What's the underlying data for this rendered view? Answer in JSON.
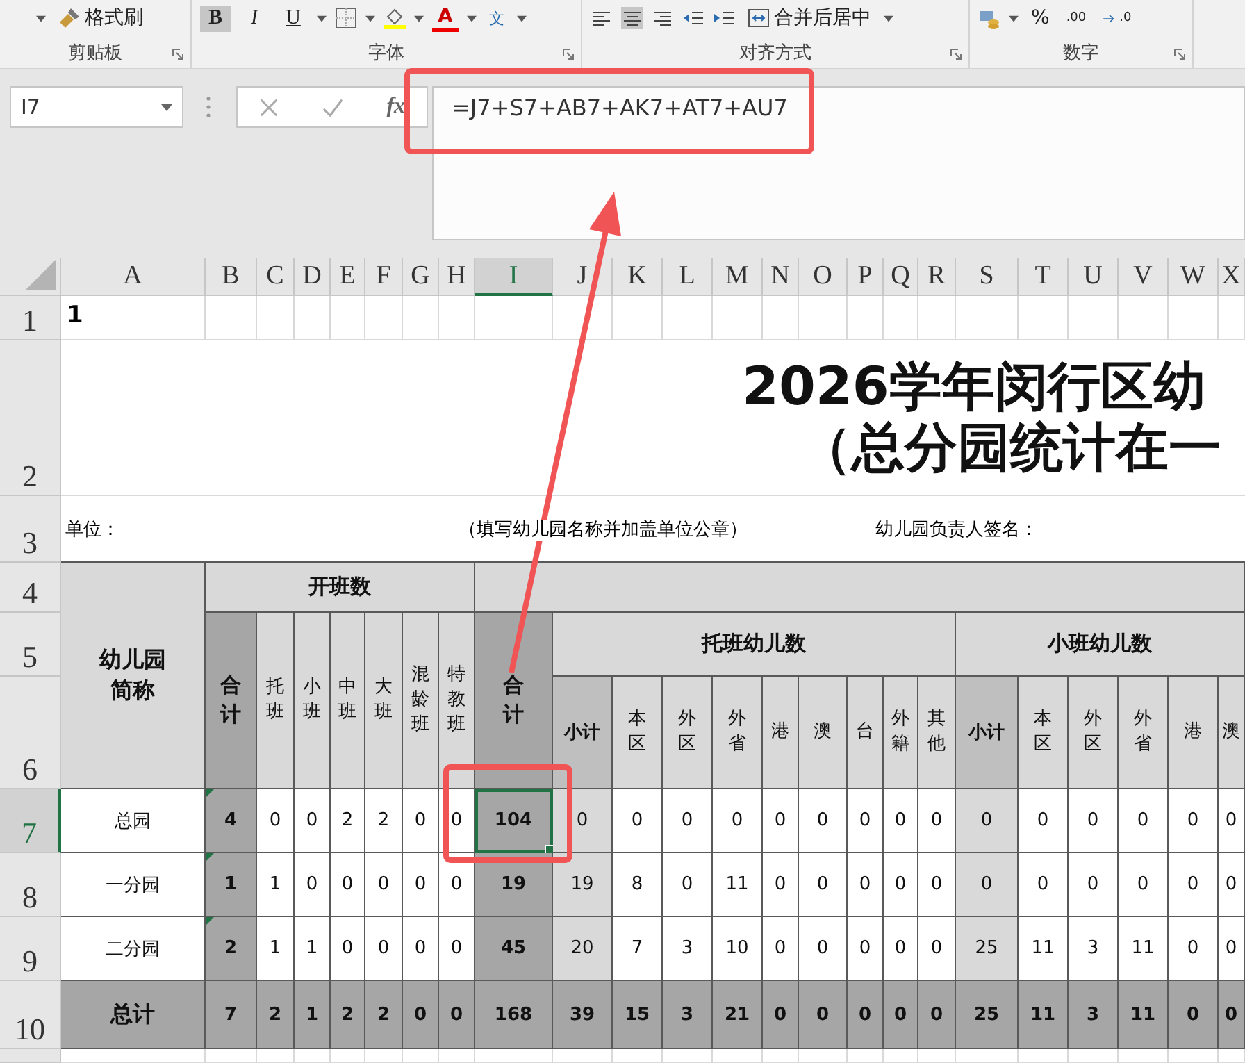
{
  "ribbon": {
    "groups": [
      {
        "label": "剪贴板",
        "items": [
          {
            "kind": "caret"
          },
          {
            "kind": "brush",
            "label": "格式刷"
          }
        ]
      },
      {
        "label": "字体",
        "items": [
          {
            "kind": "bold",
            "label": "B",
            "selected": true
          },
          {
            "kind": "italic",
            "label": "I",
            "selected": false
          },
          {
            "kind": "underline",
            "label": "U",
            "selected": false
          },
          {
            "kind": "caret"
          },
          {
            "kind": "borders"
          },
          {
            "kind": "caret"
          },
          {
            "kind": "fill"
          },
          {
            "kind": "caret"
          },
          {
            "kind": "font_color",
            "label": "A"
          },
          {
            "kind": "caret"
          },
          {
            "kind": "phonetic",
            "label": "文"
          },
          {
            "kind": "caret"
          }
        ]
      },
      {
        "label": "对齐方式",
        "items": [
          {
            "kind": "align_left",
            "selected": false
          },
          {
            "kind": "align_center",
            "selected": true
          },
          {
            "kind": "align_right",
            "selected": false
          },
          {
            "kind": "outdent"
          },
          {
            "kind": "indent"
          },
          {
            "kind": "merge",
            "label": "合并后居中"
          },
          {
            "kind": "caret"
          }
        ]
      },
      {
        "label": "数字",
        "items": [
          {
            "kind": "currency"
          },
          {
            "kind": "caret"
          },
          {
            "kind": "percent",
            "label": "%"
          },
          {
            "kind": "increase_decimal",
            "label": ".00"
          },
          {
            "kind": "decrease_decimal",
            "label": ".0"
          }
        ]
      }
    ]
  },
  "formula_bar": {
    "name_box": "I7",
    "function_label": "fx",
    "formula": "=J7+S7+AB7+AK7+AT7+AU7"
  },
  "sheet": {
    "columns": [
      {
        "label": "A",
        "selected": false
      },
      {
        "label": "B",
        "selected": false
      },
      {
        "label": "C",
        "selected": false
      },
      {
        "label": "D",
        "selected": false
      },
      {
        "label": "E",
        "selected": false
      },
      {
        "label": "F",
        "selected": false
      },
      {
        "label": "G",
        "selected": false
      },
      {
        "label": "H",
        "selected": false
      },
      {
        "label": "I",
        "selected": true
      },
      {
        "label": "J",
        "selected": false
      },
      {
        "label": "K",
        "selected": false
      },
      {
        "label": "L",
        "selected": false
      },
      {
        "label": "M",
        "selected": false
      },
      {
        "label": "N",
        "selected": false
      },
      {
        "label": "O",
        "selected": false
      },
      {
        "label": "P",
        "selected": false
      },
      {
        "label": "Q",
        "selected": false
      },
      {
        "label": "R",
        "selected": false
      },
      {
        "label": "S",
        "selected": false
      },
      {
        "label": "T",
        "selected": false
      },
      {
        "label": "U",
        "selected": false
      },
      {
        "label": "V",
        "selected": false
      },
      {
        "label": "W",
        "selected": false
      },
      {
        "label": "X",
        "selected": false
      }
    ],
    "row_numbers": [
      {
        "label": "1",
        "selected": false
      },
      {
        "label": "2",
        "selected": false
      },
      {
        "label": "3",
        "selected": false
      },
      {
        "label": "4",
        "selected": false
      },
      {
        "label": "5",
        "selected": false
      },
      {
        "label": "6",
        "selected": false
      },
      {
        "label": "7",
        "selected": true
      },
      {
        "label": "8",
        "selected": false
      },
      {
        "label": "9",
        "selected": false
      },
      {
        "label": "10",
        "selected": false
      }
    ],
    "a1": "1",
    "title": [
      "2026学年闵行区幼",
      "（总分园统计在一"
    ],
    "unit_row": {
      "unit_label": "单位：",
      "note": "（填写幼儿园名称并加盖单位公章）",
      "signature_label": "幼儿园负责人签名："
    },
    "header": {
      "name_label": "幼儿园简称",
      "class_count": {
        "label": "开班数",
        "columns": [
          {
            "label": "合计",
            "kind": "total"
          },
          {
            "label": "托班",
            "kind": "item"
          },
          {
            "label": "小班",
            "kind": "item"
          },
          {
            "label": "中班",
            "kind": "item"
          },
          {
            "label": "大班",
            "kind": "item"
          },
          {
            "label": "混龄班",
            "kind": "item"
          },
          {
            "label": "特教班",
            "kind": "item"
          }
        ]
      },
      "total": {
        "label": "合计",
        "kind": "total"
      },
      "groups": [
        {
          "label": "托班幼儿数",
          "columns": [
            {
              "label": "小计",
              "kind": "subtotal"
            },
            {
              "label": "本区",
              "kind": "item"
            },
            {
              "label": "外区",
              "kind": "item"
            },
            {
              "label": "外省",
              "kind": "item"
            },
            {
              "label": "港",
              "kind": "item"
            },
            {
              "label": "澳",
              "kind": "item"
            },
            {
              "label": "台",
              "kind": "item"
            },
            {
              "label": "外籍",
              "kind": "item"
            },
            {
              "label": "其他",
              "kind": "item"
            }
          ]
        },
        {
          "label": "小班幼儿数",
          "columns": [
            {
              "label": "小计",
              "kind": "subtotal"
            },
            {
              "label": "本区",
              "kind": "item"
            },
            {
              "label": "外区",
              "kind": "item"
            },
            {
              "label": "外省",
              "kind": "item"
            },
            {
              "label": "港",
              "kind": "item"
            },
            {
              "label": "澳",
              "kind": "item"
            }
          ]
        }
      ]
    },
    "rows": [
      {
        "name": "总园",
        "kind": "garden",
        "flag": true,
        "values": [
          "4",
          "0",
          "0",
          "2",
          "2",
          "0",
          "0",
          "104",
          "0",
          "0",
          "0",
          "0",
          "0",
          "0",
          "0",
          "0",
          "0",
          "0",
          "0",
          "0",
          "0",
          "0",
          "0"
        ]
      },
      {
        "name": "一分园",
        "kind": "garden",
        "flag": true,
        "values": [
          "1",
          "1",
          "0",
          "0",
          "0",
          "0",
          "0",
          "19",
          "19",
          "8",
          "0",
          "11",
          "0",
          "0",
          "0",
          "0",
          "0",
          "0",
          "0",
          "0",
          "0",
          "0",
          "0"
        ]
      },
      {
        "name": "二分园",
        "kind": "garden",
        "flag": true,
        "values": [
          "2",
          "1",
          "1",
          "0",
          "0",
          "0",
          "0",
          "45",
          "20",
          "7",
          "3",
          "10",
          "0",
          "0",
          "0",
          "0",
          "0",
          "25",
          "11",
          "3",
          "11",
          "0",
          "0"
        ]
      },
      {
        "name": "总计",
        "kind": "total",
        "flag": false,
        "values": [
          "7",
          "2",
          "1",
          "2",
          "2",
          "0",
          "0",
          "168",
          "39",
          "15",
          "3",
          "21",
          "0",
          "0",
          "0",
          "0",
          "0",
          "25",
          "11",
          "3",
          "11",
          "0",
          "0"
        ]
      }
    ]
  }
}
